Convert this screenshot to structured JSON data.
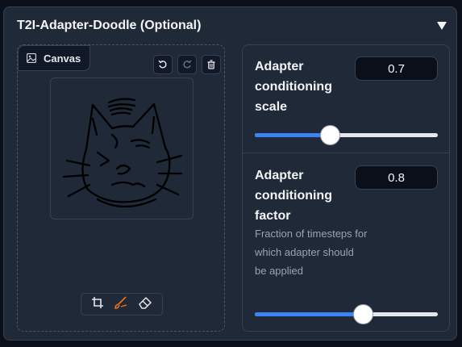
{
  "panel": {
    "title": "T2I-Adapter-Doodle (Optional)",
    "collapse_icon": "triangle-down-icon"
  },
  "canvas": {
    "tab_label": "Canvas",
    "tab_icon": "image-icon",
    "tools": [
      "undo-icon",
      "redo-icon",
      "trash-icon"
    ],
    "bottom_tools": [
      "crop-icon",
      "brush-icon",
      "eraser-icon"
    ],
    "accent": "#f97316"
  },
  "sliders": [
    {
      "label": "Adapter conditioning scale",
      "value": "0.7",
      "fraction": 0.41
    },
    {
      "label": "Adapter conditioning factor",
      "value": "0.8",
      "info": "Fraction of timesteps for which adapter should be applied",
      "fraction": 0.59
    }
  ],
  "colors": {
    "accent": "#3b82f6"
  }
}
